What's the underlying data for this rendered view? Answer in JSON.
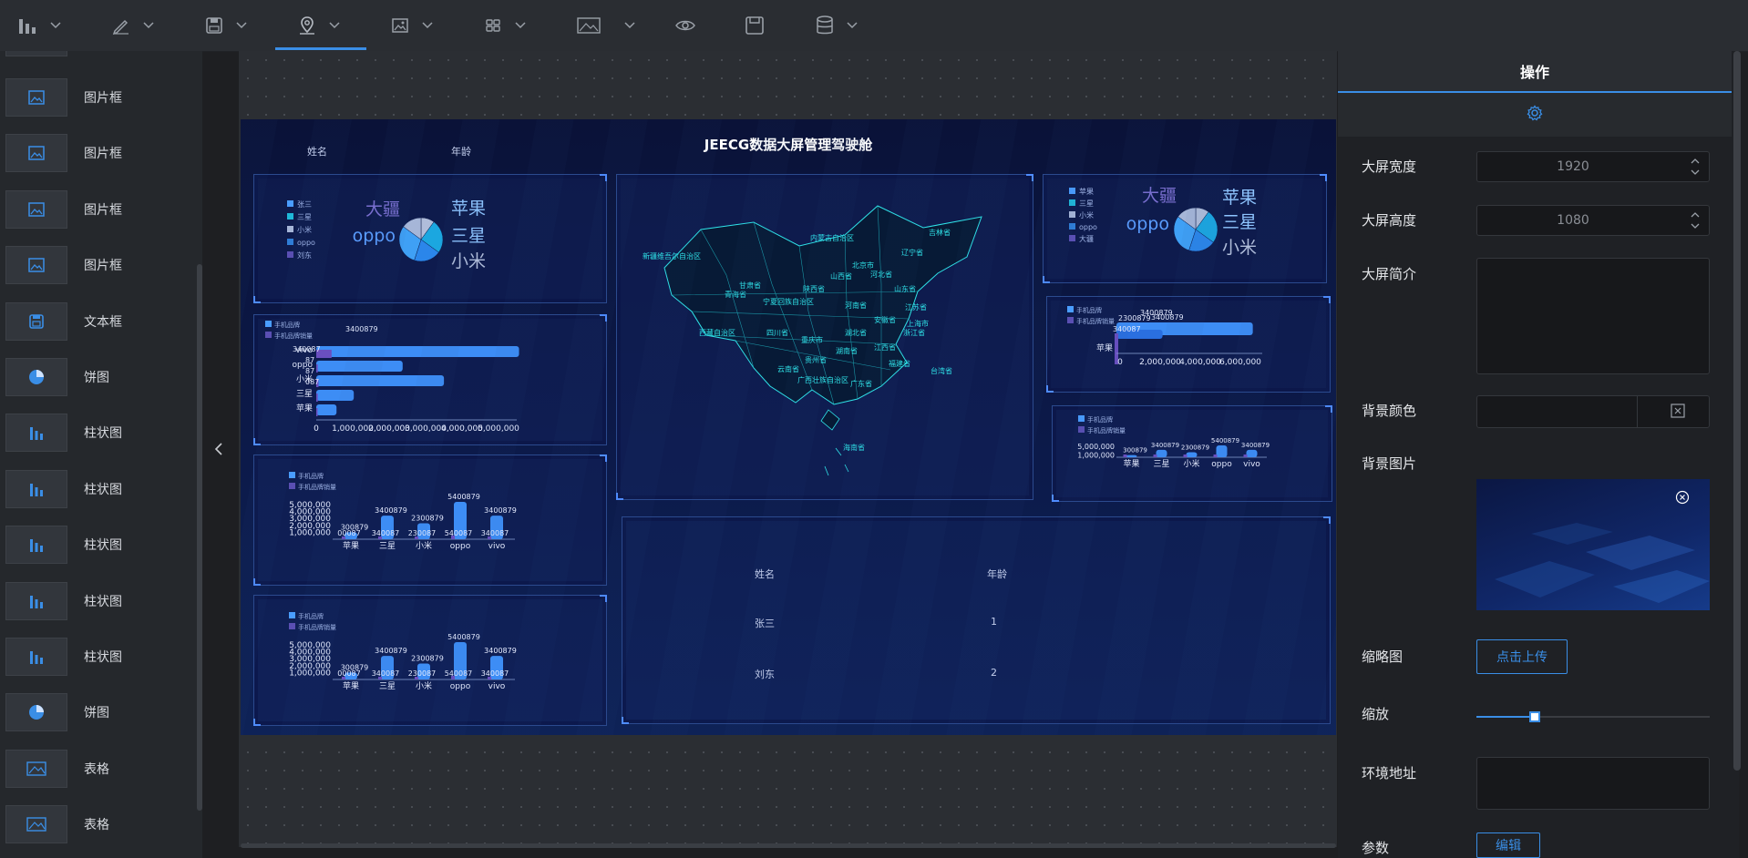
{
  "toolbar": {
    "items": [
      {
        "icon": "bar-chart-icon",
        "has_dropdown": true
      },
      {
        "icon": "pen-icon",
        "has_dropdown": true
      },
      {
        "icon": "save-icon",
        "has_dropdown": true
      },
      {
        "icon": "map-pin-icon",
        "has_dropdown": true,
        "active": true
      },
      {
        "icon": "image-icon",
        "has_dropdown": true
      },
      {
        "icon": "grid-icon",
        "has_dropdown": true
      },
      {
        "icon": "picture-icon",
        "has_dropdown": true
      },
      {
        "icon": "eye-icon",
        "has_dropdown": false
      },
      {
        "icon": "floppy-icon",
        "has_dropdown": false
      },
      {
        "icon": "database-icon",
        "has_dropdown": true
      }
    ]
  },
  "components": [
    {
      "label": "图片框",
      "icon": "image-icon"
    },
    {
      "label": "图片框",
      "icon": "image-icon"
    },
    {
      "label": "图片框",
      "icon": "image-icon"
    },
    {
      "label": "图片框",
      "icon": "image-icon"
    },
    {
      "label": "文本框",
      "icon": "save-icon"
    },
    {
      "label": "饼图",
      "icon": "pie-chart-icon"
    },
    {
      "label": "柱状图",
      "icon": "bar-chart-icon"
    },
    {
      "label": "柱状图",
      "icon": "bar-chart-icon"
    },
    {
      "label": "柱状图",
      "icon": "bar-chart-icon"
    },
    {
      "label": "柱状图",
      "icon": "bar-chart-icon"
    },
    {
      "label": "柱状图",
      "icon": "bar-chart-icon"
    },
    {
      "label": "饼图",
      "icon": "pie-chart-icon"
    },
    {
      "label": "表格",
      "icon": "picture-icon"
    },
    {
      "label": "表格",
      "icon": "picture-icon"
    }
  ],
  "screen": {
    "title": "JEECG数据大屏管理驾驶舱",
    "top_table": {
      "headers": [
        "姓名",
        "年龄"
      ]
    },
    "table": {
      "headers": [
        "姓名",
        "年龄"
      ],
      "rows": [
        [
          "张三",
          "1"
        ],
        [
          "刘东",
          "2"
        ]
      ]
    }
  },
  "chart_data": [
    {
      "type": "pie",
      "id": "pie-left",
      "legend": [
        "张三",
        "三星",
        "小米",
        "oppo",
        "刘东"
      ],
      "labels": [
        "大疆",
        "苹果",
        "oppo",
        "三星",
        "小米"
      ],
      "values": [
        10,
        25,
        20,
        30,
        15
      ]
    },
    {
      "type": "bar",
      "id": "hbar-left",
      "orientation": "horizontal",
      "legend": [
        "手机品牌",
        "手机品牌销量"
      ],
      "categories": [
        "苹果",
        "三星",
        "小米",
        "oppo",
        "vivo"
      ],
      "series": [
        {
          "name": "手机品牌",
          "values": [
            540087,
            1000000,
            3400879,
            2300879,
            5400879
          ]
        },
        {
          "name": "手机品牌销量",
          "values": [
            300000,
            340087,
            500000,
            340087,
            3400879
          ]
        }
      ],
      "ticks": [
        "0",
        "1,000,000",
        "2,000,000",
        "3,000,000",
        "4,000,000",
        "5,000,000"
      ],
      "value_labels": [
        "3400879",
        "340087",
        "87",
        "87",
        "087"
      ]
    },
    {
      "type": "bar",
      "id": "vbar-left-1",
      "legend": [
        "手机品牌",
        "手机品牌销量"
      ],
      "categories": [
        "苹果",
        "三星",
        "小米",
        "oppo",
        "vivo"
      ],
      "series": [
        {
          "name": "手机品牌",
          "values": [
            1000087,
            3400879,
            2300879,
            5400879,
            3400879
          ]
        },
        {
          "name": "手机品牌销量",
          "values": [
            300879,
            340087,
            230087,
            540087,
            340087
          ]
        }
      ],
      "ticks": [
        "1,000,000",
        "2,000,000",
        "3,000,000",
        "4,000,000",
        "5,000,000"
      ],
      "value_labels_top": [
        "300879",
        "3400879",
        "2300879",
        "5400879",
        "3400879"
      ],
      "value_labels_bottom": [
        "00087",
        "340087",
        "230087",
        "540087",
        "340087"
      ]
    },
    {
      "type": "bar",
      "id": "vbar-left-2",
      "legend": [
        "手机品牌",
        "手机品牌销量"
      ],
      "categories": [
        "苹果",
        "三星",
        "小米",
        "oppo",
        "vivo"
      ],
      "series": [
        {
          "name": "手机品牌",
          "values": [
            1000087,
            3400879,
            2300879,
            5400879,
            3400879
          ]
        },
        {
          "name": "手机品牌销量",
          "values": [
            300879,
            340087,
            230087,
            540087,
            340087
          ]
        }
      ],
      "ticks": [
        "1,000,000",
        "2,000,000",
        "3,000,000",
        "4,000,000",
        "5,000,000"
      ],
      "value_labels_top": [
        "300879",
        "3400879",
        "2300879",
        "5400879",
        "3400879"
      ],
      "value_labels_bottom": [
        "00087",
        "340087",
        "230087",
        "540087",
        "340087"
      ]
    },
    {
      "type": "pie",
      "id": "pie-right",
      "legend": [
        "苹果",
        "三星",
        "小米",
        "oppo",
        "大疆"
      ],
      "labels": [
        "大疆",
        "苹果",
        "oppo",
        "三星",
        "小米"
      ],
      "values": [
        10,
        25,
        20,
        30,
        15
      ]
    },
    {
      "type": "bar",
      "id": "hbar-right",
      "orientation": "horizontal",
      "legend": [
        "手机品牌",
        "手机品牌销量"
      ],
      "categories": [
        "苹果"
      ],
      "series": [
        {
          "name": "手机品牌",
          "values": [
            3400879
          ]
        },
        {
          "name": "手机品牌销量",
          "values": [
            2300879
          ]
        }
      ],
      "ticks": [
        "0",
        "2,000,000",
        "4,000,000",
        "6,000,000"
      ],
      "value_labels": [
        "3400879",
        "2300879",
        "3400879",
        "340087"
      ]
    },
    {
      "type": "bar",
      "id": "vbar-right",
      "legend": [
        "手机品牌",
        "手机品牌销量"
      ],
      "categories": [
        "苹果",
        "三星",
        "小米",
        "oppo",
        "vivo"
      ],
      "series": [
        {
          "name": "手机品牌",
          "values": [
            1000087,
            3400879,
            2300879,
            5400879,
            3400879
          ]
        },
        {
          "name": "手机品牌销量",
          "values": [
            300879,
            340087,
            230087,
            540087,
            340087
          ]
        }
      ],
      "ticks": [
        "1,000,000",
        "5,000,000"
      ],
      "value_labels_top": [
        "300879",
        "3400879",
        "2300879",
        "5400879",
        "3400879"
      ]
    },
    {
      "type": "map",
      "id": "china-map",
      "region_labels": [
        "内蒙古自治区",
        "新疆维吾尔自治区",
        "甘肃省",
        "青海省",
        "西藏自治区",
        "四川省",
        "云南省",
        "陕西省",
        "山西省",
        "河北省",
        "山东省",
        "河南省",
        "湖北省",
        "湖南省",
        "重庆市",
        "贵州省",
        "广西壮族自治区",
        "广东省",
        "江西省",
        "福建省",
        "浙江省",
        "江苏省",
        "安徽省",
        "上海市",
        "北京市",
        "辽宁省",
        "吉林省",
        "宁夏回族自治区",
        "台湾省",
        "海南省"
      ]
    }
  ],
  "right_panel": {
    "tab_label": "操作",
    "settings_icon": "gear-icon",
    "fields": {
      "width_label": "大屏宽度",
      "width_value": "1920",
      "height_label": "大屏高度",
      "height_value": "1080",
      "desc_label": "大屏简介",
      "desc_value": "",
      "bgcolor_label": "背景颜色",
      "bgcolor_value": "",
      "bgimage_label": "背景图片",
      "thumb_label": "缩略图",
      "upload_label": "点击上传",
      "zoom_label": "缩放",
      "zoom_value": 0.25,
      "env_label": "环境地址",
      "env_value": "",
      "params_label": "参数",
      "edit_label": "编辑"
    }
  }
}
